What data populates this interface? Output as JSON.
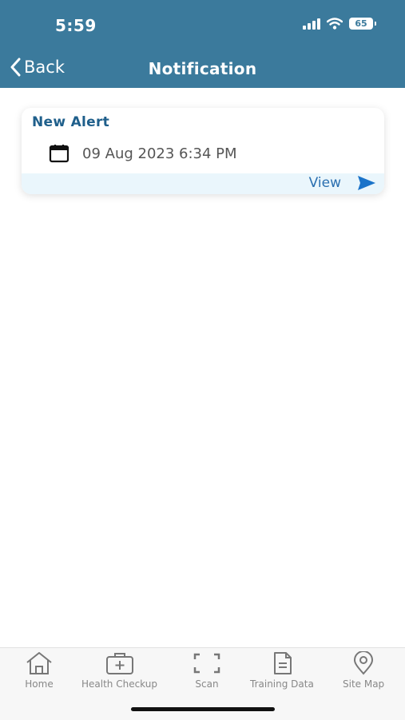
{
  "status_bar": {
    "time": "5:59",
    "battery": "65"
  },
  "header": {
    "back_label": "Back",
    "title": "Notification"
  },
  "notifications": [
    {
      "title": "New Alert",
      "date": "09 Aug 2023 6:34 PM",
      "action_label": "View"
    }
  ],
  "tabbar": {
    "items": [
      {
        "label": "Home",
        "icon": "home-icon"
      },
      {
        "label": "Health Checkup",
        "icon": "medical-kit-icon"
      },
      {
        "label": "Scan",
        "icon": "scan-icon"
      },
      {
        "label": "Training Data",
        "icon": "document-icon"
      },
      {
        "label": "Site Map",
        "icon": "location-pin-icon"
      }
    ]
  },
  "colors": {
    "header_bg": "#3b7a9c",
    "card_title": "#1f5f8b",
    "link": "#2a6fb0",
    "send_icon": "#1a73c9",
    "card_footer_bg": "#eaf6fc"
  }
}
